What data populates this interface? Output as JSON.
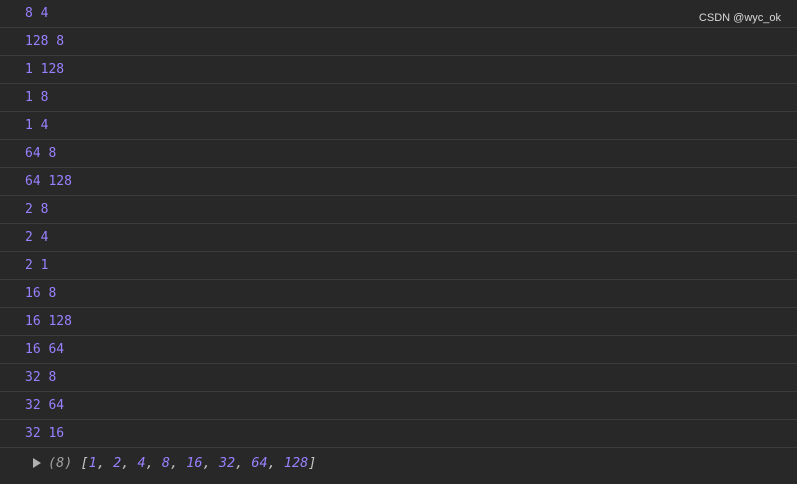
{
  "console": {
    "log_lines": [
      "8 4",
      "128 8",
      "1 128",
      "1 8",
      "1 4",
      "64 8",
      "64 128",
      "2 8",
      "2 4",
      "2 1",
      "16 8",
      "16 128",
      "16 64",
      "32 8",
      "32 64",
      "32 16"
    ],
    "result": {
      "length_label": "(8)",
      "open_bracket": "[",
      "items": [
        "1",
        "2",
        "4",
        "8",
        "16",
        "32",
        "64",
        "128"
      ],
      "close_bracket": "]"
    }
  },
  "watermark": "CSDN @wyc_ok",
  "colors": {
    "background": "#282828",
    "value_purple": "#9980ff",
    "divider": "#3c3c3c"
  }
}
